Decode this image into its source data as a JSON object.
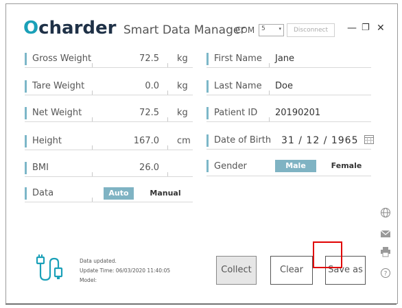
{
  "header": {
    "logo_prefix": "O",
    "logo_rest": "charder",
    "app_title": "Smart Data Manager",
    "com_label": "COM",
    "com_value": "5",
    "disconnect_label": "Disconnect",
    "minimize": "—",
    "restore": "❐",
    "close": "✕"
  },
  "left_fields": [
    {
      "label": "Gross Weight",
      "value": "72.5",
      "unit": "kg"
    },
    {
      "label": "Tare Weight",
      "value": "0.0",
      "unit": "kg"
    },
    {
      "label": "Net Weight",
      "value": "72.5",
      "unit": "kg"
    },
    {
      "label": "Height",
      "value": "167.0",
      "unit": "cm"
    },
    {
      "label": "BMI",
      "value": "26.0",
      "unit": ""
    }
  ],
  "data_mode": {
    "label": "Data",
    "auto": "Auto",
    "manual": "Manual",
    "selected": "Auto"
  },
  "right_fields": [
    {
      "label": "First Name",
      "value": "Jane"
    },
    {
      "label": "Last Name",
      "value": "Doe"
    },
    {
      "label": "Patient ID",
      "value": "20190201"
    },
    {
      "label": "Date of Birth",
      "value": "31 / 12 / 1965"
    }
  ],
  "gender": {
    "label": "Gender",
    "male": "Male",
    "female": "Female",
    "selected": "Male"
  },
  "status": {
    "line1": "Data updated.",
    "line2": "Update Time: 06/03/2020 11:40:05",
    "line3": "Model:"
  },
  "buttons": {
    "collect": "Collect",
    "clear": "Clear",
    "save_as": "Save as"
  },
  "colors": {
    "accent": "#7fb3c3",
    "logo_dark": "#1f3147",
    "logo_teal": "#1aa0b8",
    "highlight": "#e00000"
  },
  "side_icons": [
    "globe-icon",
    "mail-icon",
    "printer-icon",
    "help-icon"
  ]
}
